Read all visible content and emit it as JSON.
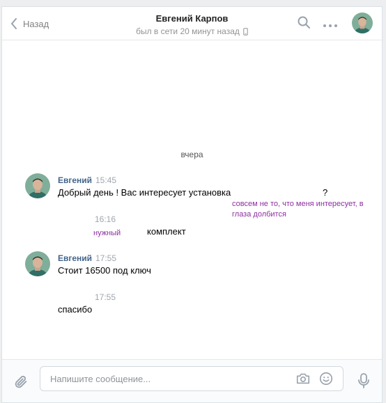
{
  "header": {
    "back_label": "Назад",
    "peer_name": "Евгений Карпов",
    "peer_status": "был в сети 20 минут назад",
    "icons": [
      "chevron-left-icon",
      "mobile-phone-icon",
      "search-icon",
      "more-dots-icon",
      "avatar"
    ]
  },
  "day_separator": "вчера",
  "messages": [
    {
      "author": "Евгений",
      "time": "15:45",
      "text": "Добрый день ! Вас интересует установка",
      "trailing": "?"
    },
    {
      "author": "",
      "time": "16:16",
      "text": "комплект"
    },
    {
      "author": "Евгений",
      "time": "17:55",
      "text": "Стоит 16500 под ключ"
    },
    {
      "author": "",
      "time": "17:55",
      "text": "спасибо"
    }
  ],
  "annotations": [
    {
      "text": "совсем не то, что меня интересует, в глаза долбится"
    },
    {
      "text": "нужный"
    }
  ],
  "composer": {
    "placeholder": "Напишите сообщение...",
    "value": ""
  },
  "colors": {
    "author": "#42648b",
    "annotation": "#8d2fa0",
    "icon": "#99a2ad"
  }
}
